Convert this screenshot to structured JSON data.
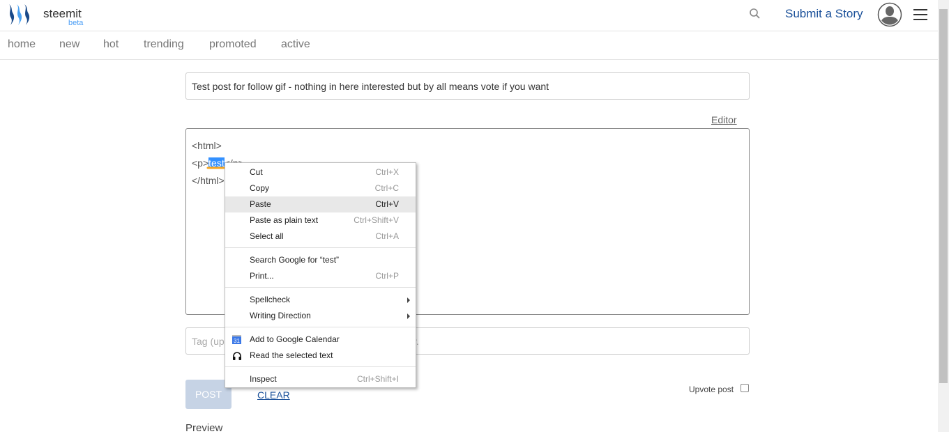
{
  "header": {
    "brand": "steemit",
    "beta": "beta",
    "submit": "Submit a Story",
    "icons": [
      "steemit-logo",
      "search-icon",
      "avatar-icon",
      "hamburger-icon"
    ]
  },
  "nav": [
    "home",
    "new",
    "hot",
    "trending",
    "promoted",
    "active"
  ],
  "form": {
    "title_value": "Test post for follow gif - nothing in here interested but by all means vote if you want",
    "editor_link": "Editor",
    "body_line1": "<html>",
    "body_line2_pre": "<p>",
    "body_selected": "test",
    "body_line2_post": "</p>",
    "body_line3": "</html>",
    "tag_placeholder": "Tag (up to 5 tags), the first tag is your main category.",
    "post": "POST",
    "clear": "CLEAR",
    "upvote": "Upvote post",
    "upvote_checked": false,
    "preview": "Preview"
  },
  "context_menu": [
    {
      "label": "Cut",
      "shortcut": "Ctrl+X"
    },
    {
      "label": "Copy",
      "shortcut": "Ctrl+C"
    },
    {
      "label": "Paste",
      "shortcut": "Ctrl+V",
      "highlighted": true
    },
    {
      "label": "Paste as plain text",
      "shortcut": "Ctrl+Shift+V"
    },
    {
      "label": "Select all",
      "shortcut": "Ctrl+A"
    },
    {
      "label": "Search Google for “test”"
    },
    {
      "label": "Print...",
      "shortcut": "Ctrl+P"
    },
    {
      "label": "Spellcheck",
      "submenu": true
    },
    {
      "label": "Writing Direction",
      "submenu": true
    },
    {
      "label": "Add to Google Calendar",
      "icon": "calendar-icon",
      "icon_text": "31"
    },
    {
      "label": "Read the selected text",
      "icon": "headphones-icon"
    },
    {
      "label": "Inspect",
      "shortcut": "Ctrl+Shift+I"
    }
  ],
  "colors": {
    "accent": "#1a5099",
    "annotation": "#f5a623",
    "selection": "#3390ff"
  }
}
